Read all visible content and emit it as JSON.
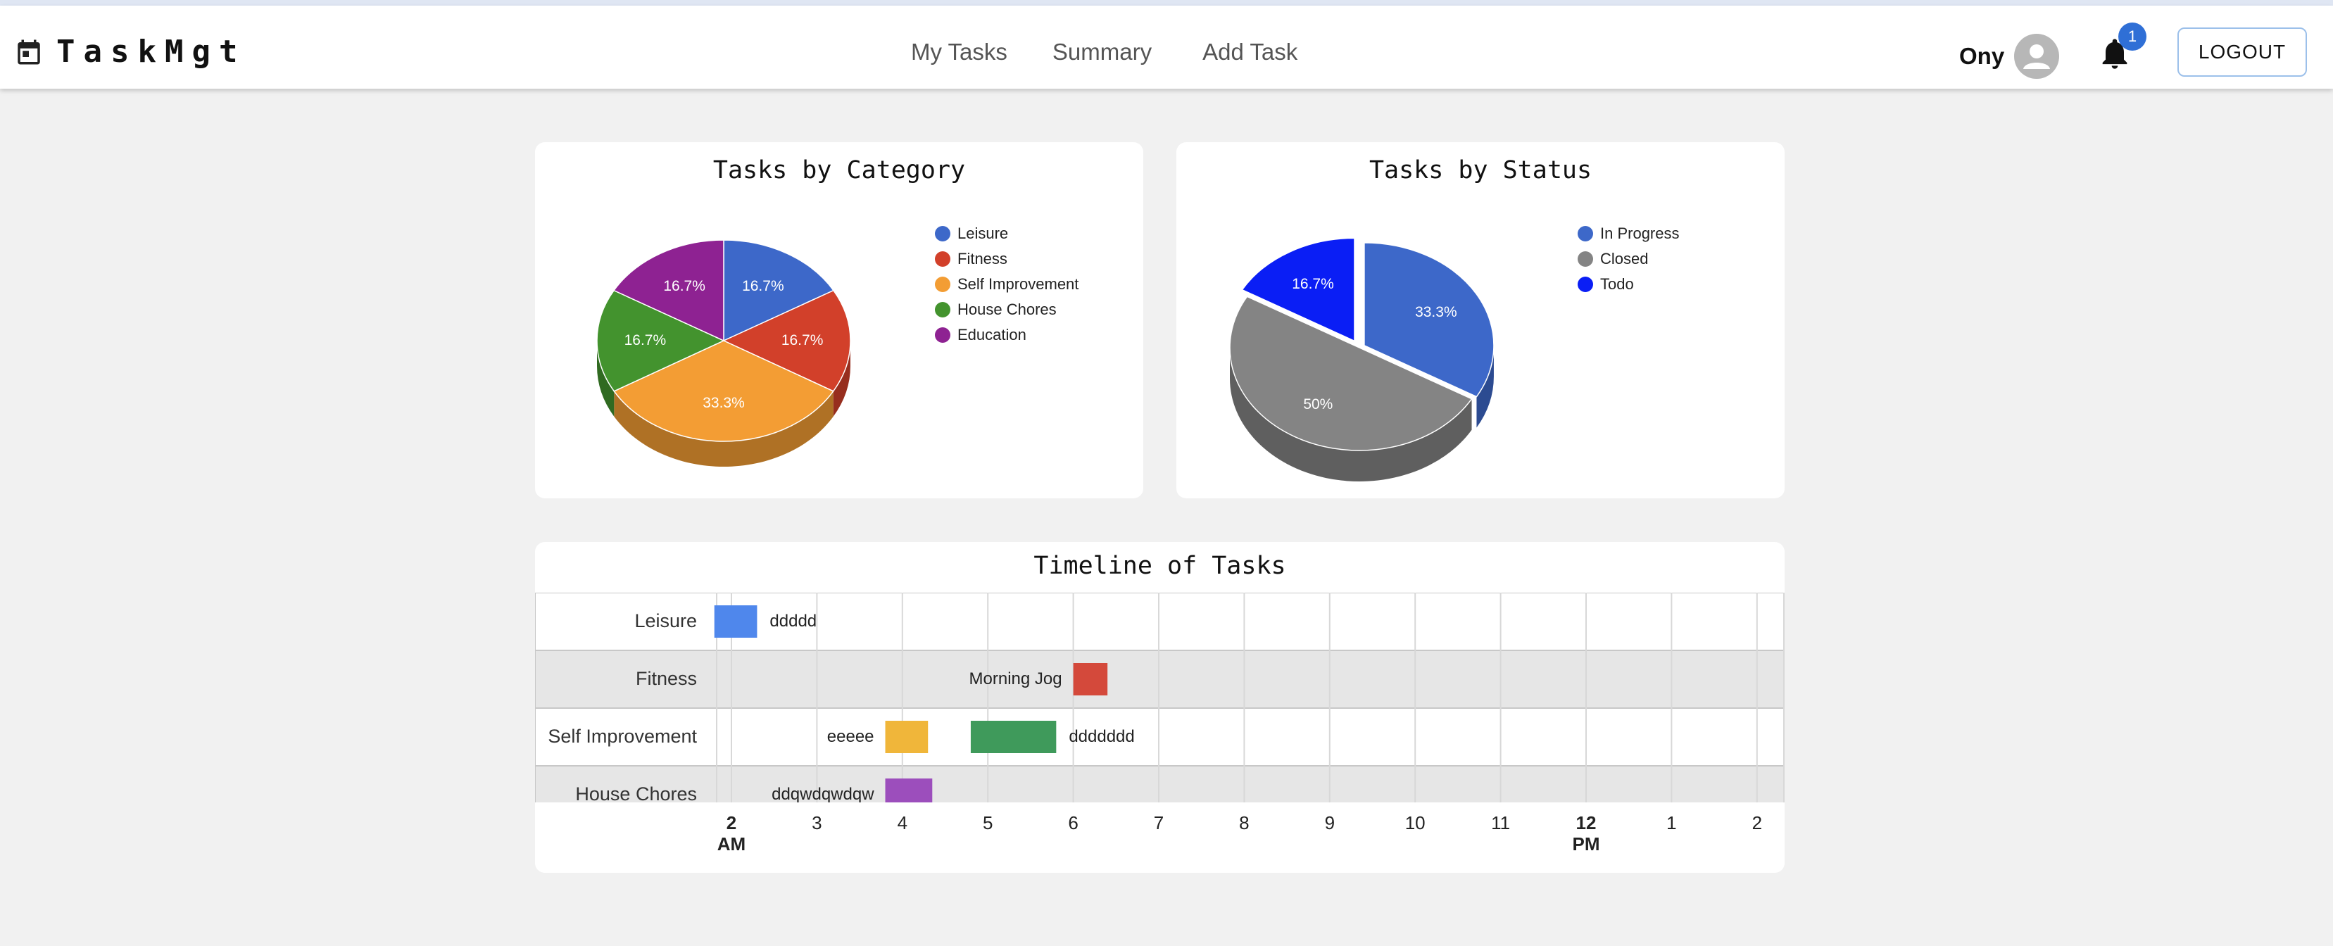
{
  "app": {
    "brand": "TaskMgt"
  },
  "nav": {
    "links": [
      "My Tasks",
      "Summary",
      "Add Task"
    ]
  },
  "user": {
    "name": "Ony",
    "notification_count": "1",
    "logout_label": "LOGOUT"
  },
  "category_chart": {
    "title": "Tasks by Category",
    "chart_data": {
      "type": "pie",
      "title": "Tasks by Category",
      "legend_position": "right",
      "slices": [
        {
          "label": "Leisure",
          "value": 16.7,
          "color": "#3d68c9"
        },
        {
          "label": "Fitness",
          "value": 16.7,
          "color": "#d2402a"
        },
        {
          "label": "Self Improvement",
          "value": 33.3,
          "color": "#f39d34"
        },
        {
          "label": "House Chores",
          "value": 16.7,
          "color": "#43932e"
        },
        {
          "label": "Education",
          "value": 16.7,
          "color": "#8e2292"
        }
      ],
      "slice_labels": [
        "16.7%",
        "16.7%",
        "33.3%",
        "16.7%",
        "16.7%"
      ]
    }
  },
  "status_chart": {
    "title": "Tasks by Status",
    "chart_data": {
      "type": "pie",
      "title": "Tasks by Status",
      "legend_position": "right",
      "slices": [
        {
          "label": "In Progress",
          "value": 33.3,
          "color": "#3d68c9"
        },
        {
          "label": "Closed",
          "value": 50,
          "color": "#848484"
        },
        {
          "label": "Todo",
          "value": 16.7,
          "color": "#0a1ef5"
        }
      ],
      "slice_labels": [
        "33.3%",
        "50%",
        "16.7%"
      ]
    }
  },
  "timeline": {
    "title": "Timeline of Tasks",
    "chart_data": {
      "type": "timeline",
      "rows": [
        "Leisure",
        "Fitness",
        "Self Improvement",
        "House Chores"
      ],
      "x_ticks": [
        {
          "top": "2",
          "bottom": "AM",
          "bold": true
        },
        {
          "top": "3"
        },
        {
          "top": "4"
        },
        {
          "top": "5"
        },
        {
          "top": "6"
        },
        {
          "top": "7"
        },
        {
          "top": "8"
        },
        {
          "top": "9"
        },
        {
          "top": "10"
        },
        {
          "top": "11"
        },
        {
          "top": "12",
          "bottom": "PM",
          "bold": true
        },
        {
          "top": "1"
        },
        {
          "top": "2"
        }
      ],
      "tasks": [
        {
          "row": "Leisure",
          "name": "ddddd",
          "start": 1.8,
          "end": 2.3,
          "color": "#4f87ec",
          "label_side": "right"
        },
        {
          "row": "Fitness",
          "name": "Morning Jog",
          "start": 6.0,
          "end": 6.4,
          "color": "#d4493b",
          "label_side": "left"
        },
        {
          "row": "Self Improvement",
          "name": "eeeee",
          "start": 3.8,
          "end": 4.3,
          "color": "#f0b63a",
          "label_side": "left"
        },
        {
          "row": "Self Improvement",
          "name": "ddddddd",
          "start": 4.8,
          "end": 5.8,
          "color": "#3f9a5b",
          "label_side": "right"
        },
        {
          "row": "House Chores",
          "name": "ddqwdqwdqw",
          "start": 3.8,
          "end": 4.35,
          "color": "#9c4ebc",
          "label_side": "left"
        }
      ]
    }
  }
}
